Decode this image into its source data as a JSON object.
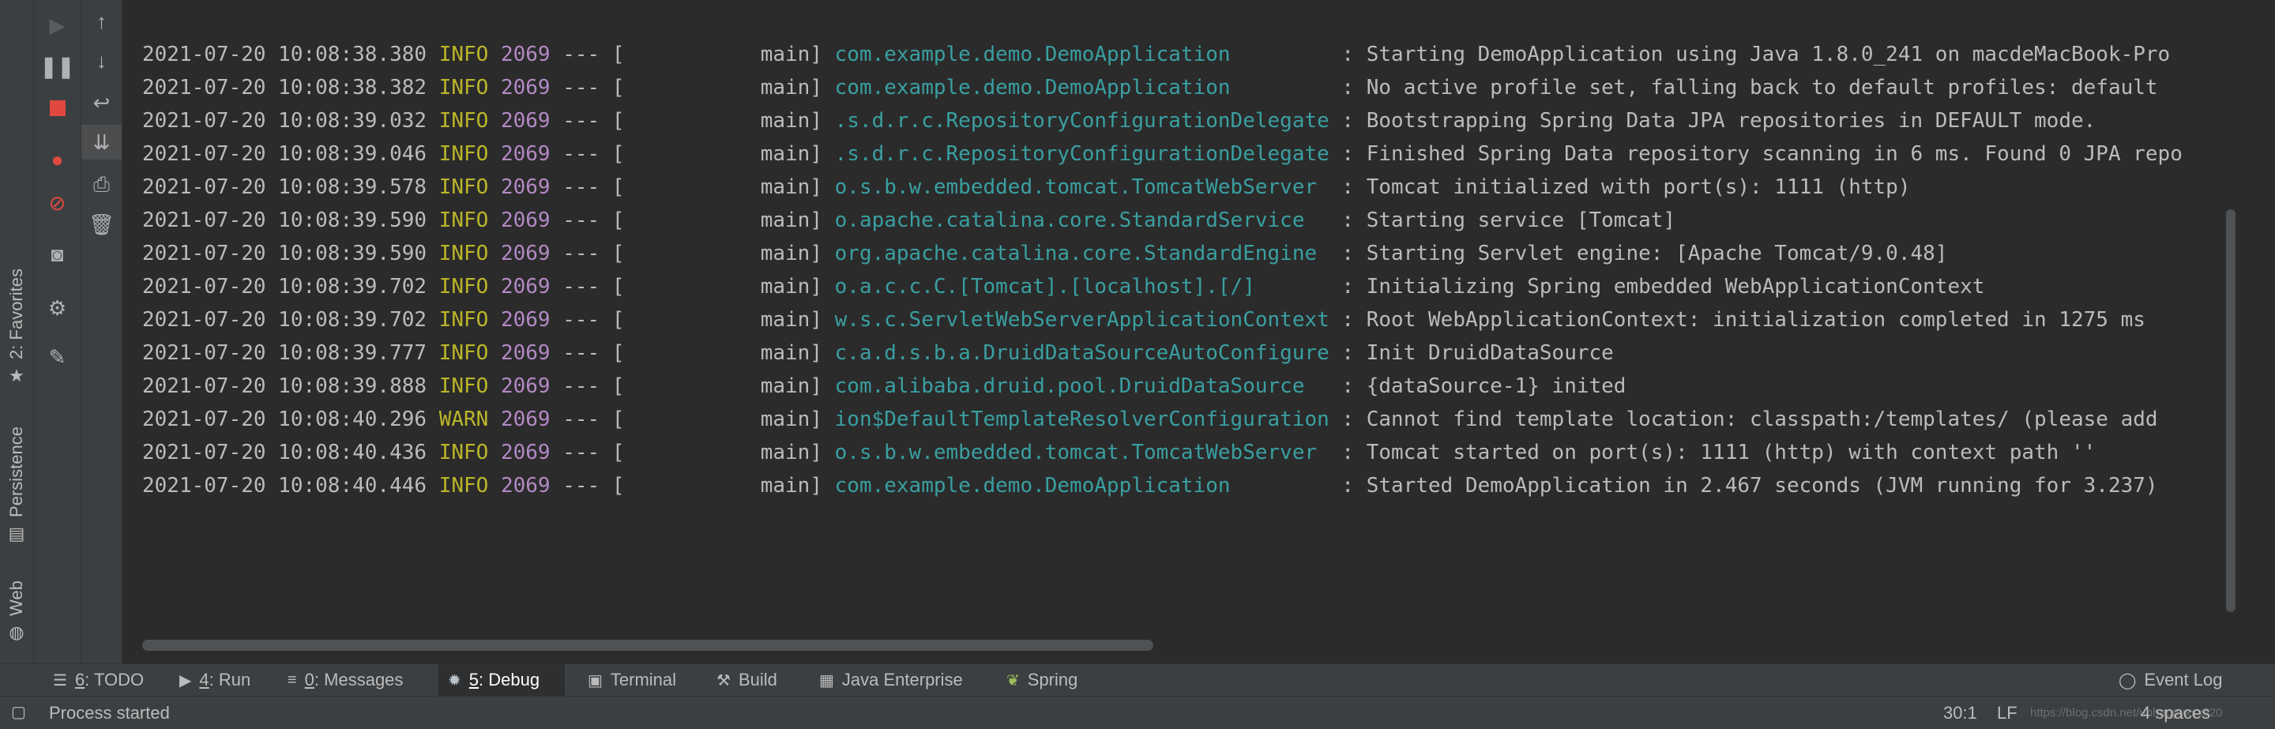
{
  "left_strip": {
    "favorites": {
      "label": "2: Favorites",
      "icon": "star-icon"
    },
    "persistence": {
      "label": "Persistence",
      "icon": "persistence-icon"
    },
    "web": {
      "label": "Web",
      "icon": "globe-icon"
    }
  },
  "debug_toolbar": [
    "resume-icon",
    "pause-icon",
    "stop-icon",
    "view-breakpoints-icon",
    "mute-breakpoints-icon",
    "camera-icon",
    "settings-icon",
    "pin-icon"
  ],
  "console_toolbar": [
    "up-arrow-icon",
    "down-arrow-icon",
    "soft-wrap-icon",
    "scroll-to-end-icon",
    "print-icon",
    "trash-icon"
  ],
  "log_lines": [
    {
      "ts": "2021-07-20 10:08:38.380",
      "level": "INFO",
      "pid": "2069",
      "sep": "---",
      "thread": "[           main]",
      "logger": "com.example.demo.DemoApplication        ",
      "msg": " : Starting DemoApplication using Java 1.8.0_241 on macdeMacBook-Pro"
    },
    {
      "ts": "2021-07-20 10:08:38.382",
      "level": "INFO",
      "pid": "2069",
      "sep": "---",
      "thread": "[           main]",
      "logger": "com.example.demo.DemoApplication        ",
      "msg": " : No active profile set, falling back to default profiles: default"
    },
    {
      "ts": "2021-07-20 10:08:39.032",
      "level": "INFO",
      "pid": "2069",
      "sep": "---",
      "thread": "[           main]",
      "logger": ".s.d.r.c.RepositoryConfigurationDelegate",
      "msg": " : Bootstrapping Spring Data JPA repositories in DEFAULT mode."
    },
    {
      "ts": "2021-07-20 10:08:39.046",
      "level": "INFO",
      "pid": "2069",
      "sep": "---",
      "thread": "[           main]",
      "logger": ".s.d.r.c.RepositoryConfigurationDelegate",
      "msg": " : Finished Spring Data repository scanning in 6 ms. Found 0 JPA repo"
    },
    {
      "ts": "2021-07-20 10:08:39.578",
      "level": "INFO",
      "pid": "2069",
      "sep": "---",
      "thread": "[           main]",
      "logger": "o.s.b.w.embedded.tomcat.TomcatWebServer ",
      "msg": " : Tomcat initialized with port(s): 1111 (http)"
    },
    {
      "ts": "2021-07-20 10:08:39.590",
      "level": "INFO",
      "pid": "2069",
      "sep": "---",
      "thread": "[           main]",
      "logger": "o.apache.catalina.core.StandardService  ",
      "msg": " : Starting service [Tomcat]"
    },
    {
      "ts": "2021-07-20 10:08:39.590",
      "level": "INFO",
      "pid": "2069",
      "sep": "---",
      "thread": "[           main]",
      "logger": "org.apache.catalina.core.StandardEngine ",
      "msg": " : Starting Servlet engine: [Apache Tomcat/9.0.48]"
    },
    {
      "ts": "2021-07-20 10:08:39.702",
      "level": "INFO",
      "pid": "2069",
      "sep": "---",
      "thread": "[           main]",
      "logger": "o.a.c.c.C.[Tomcat].[localhost].[/]      ",
      "msg": " : Initializing Spring embedded WebApplicationContext"
    },
    {
      "ts": "2021-07-20 10:08:39.702",
      "level": "INFO",
      "pid": "2069",
      "sep": "---",
      "thread": "[           main]",
      "logger": "w.s.c.ServletWebServerApplicationContext",
      "msg": " : Root WebApplicationContext: initialization completed in 1275 ms"
    },
    {
      "ts": "2021-07-20 10:08:39.777",
      "level": "INFO",
      "pid": "2069",
      "sep": "---",
      "thread": "[           main]",
      "logger": "c.a.d.s.b.a.DruidDataSourceAutoConfigure",
      "msg": " : Init DruidDataSource"
    },
    {
      "ts": "2021-07-20 10:08:39.888",
      "level": "INFO",
      "pid": "2069",
      "sep": "---",
      "thread": "[           main]",
      "logger": "com.alibaba.druid.pool.DruidDataSource  ",
      "msg": " : {dataSource-1} inited"
    },
    {
      "ts": "2021-07-20 10:08:40.296",
      "level": "WARN",
      "pid": "2069",
      "sep": "---",
      "thread": "[           main]",
      "logger": "ion$DefaultTemplateResolverConfiguration",
      "msg": " : Cannot find template location: classpath:/templates/ (please add"
    },
    {
      "ts": "2021-07-20 10:08:40.436",
      "level": "INFO",
      "pid": "2069",
      "sep": "---",
      "thread": "[           main]",
      "logger": "o.s.b.w.embedded.tomcat.TomcatWebServer ",
      "msg": " : Tomcat started on port(s): 1111 (http) with context path ''"
    },
    {
      "ts": "2021-07-20 10:08:40.446",
      "level": "INFO",
      "pid": "2069",
      "sep": "---",
      "thread": "[           main]",
      "logger": "com.example.demo.DemoApplication        ",
      "msg": " : Started DemoApplication in 2.467 seconds (JVM running for 3.237)"
    }
  ],
  "bottom_tabs": [
    {
      "mnemonic": "6",
      "label": ": TODO",
      "icon": "list-icon"
    },
    {
      "mnemonic": "4",
      "label": ": Run",
      "icon": "play-icon"
    },
    {
      "mnemonic": "0",
      "label": ": Messages",
      "icon": "messages-icon"
    },
    {
      "mnemonic": "5",
      "label": ": Debug",
      "icon": "bug-icon",
      "active": true
    },
    {
      "mnemonic": "",
      "label": "Terminal",
      "icon": "terminal-icon"
    },
    {
      "mnemonic": "",
      "label": "Build",
      "icon": "hammer-icon"
    },
    {
      "mnemonic": "",
      "label": "Java Enterprise",
      "icon": "java-enterprise-icon"
    },
    {
      "mnemonic": "",
      "label": "Spring",
      "icon": "spring-leaf-icon"
    }
  ],
  "event_log": "Event Log",
  "status": {
    "text": "Process started",
    "position": "30:1",
    "line_sep": "LF",
    "watermark": "https://blog.csdn.net/unhappyxxx520",
    "indent": "4 spaces"
  },
  "colors": {
    "background": "#2b2b2b",
    "panel": "#3c3f41",
    "info": "#bbb529",
    "pid": "#b389c5",
    "logger": "#3a9fa1"
  }
}
